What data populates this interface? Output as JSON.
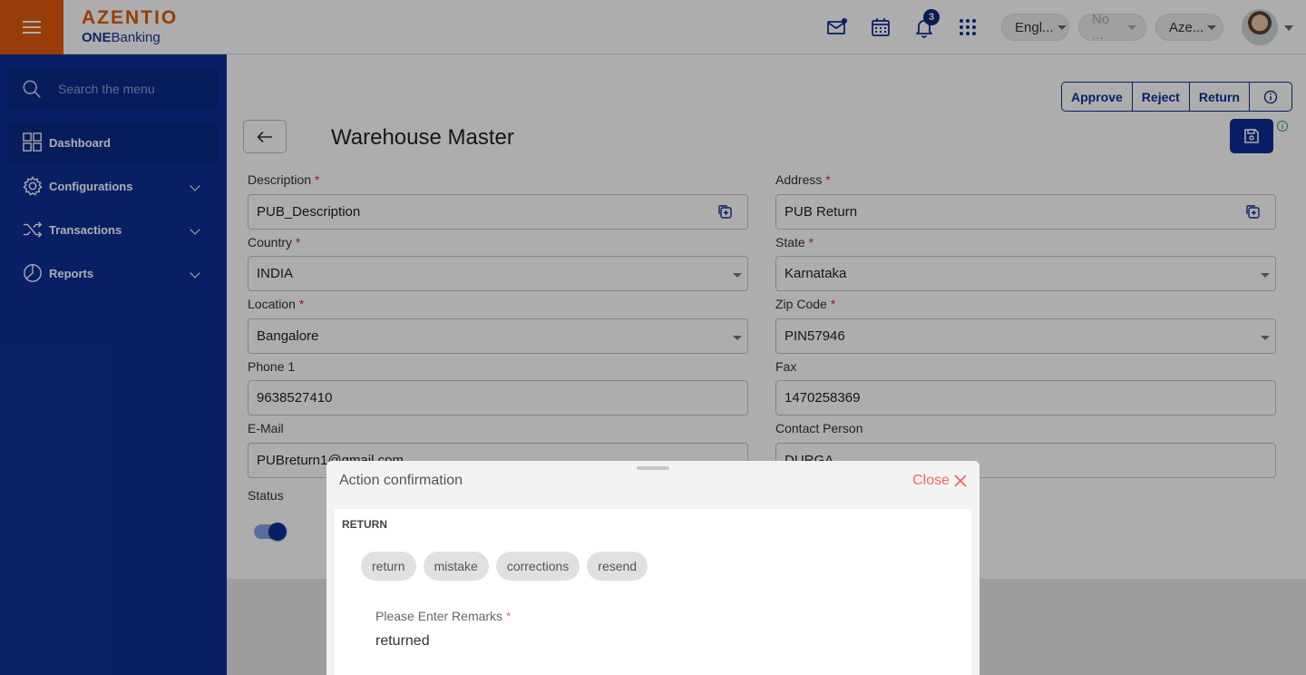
{
  "header": {
    "logo_main": "AZENTIO",
    "logo_sub_bold": "ONE",
    "logo_sub_rest": "Banking",
    "notification_count": "3",
    "language": "Engl...",
    "second_select": "No ...",
    "third_select": "Aze..."
  },
  "sidebar": {
    "search_placeholder": "Search the menu",
    "items": [
      {
        "label": "Dashboard",
        "icon": "dashboard-icon"
      },
      {
        "label": "Configurations",
        "icon": "gear-icon"
      },
      {
        "label": "Transactions",
        "icon": "shuffle-icon"
      },
      {
        "label": "Reports",
        "icon": "pie-chart-icon"
      }
    ]
  },
  "actions": {
    "approve": "Approve",
    "reject": "Reject",
    "return": "Return"
  },
  "page": {
    "title": "Warehouse Master"
  },
  "form": {
    "description": {
      "label": "Description",
      "value": "PUB_Description"
    },
    "address": {
      "label": "Address",
      "value": "PUB Return"
    },
    "country": {
      "label": "Country",
      "value": "INDIA"
    },
    "state": {
      "label": "State",
      "value": "Karnataka"
    },
    "location": {
      "label": "Location",
      "value": "Bangalore"
    },
    "zip": {
      "label": "Zip Code",
      "value": "PIN57946"
    },
    "phone1": {
      "label": "Phone 1",
      "value": "9638527410"
    },
    "fax": {
      "label": "Fax",
      "value": "1470258369"
    },
    "email": {
      "label": "E-Mail",
      "value": "PUBreturn1@gmail.com"
    },
    "contact": {
      "label": "Contact Person",
      "value": "DURGA"
    },
    "status": {
      "label": "Status",
      "on": true
    },
    "required_mark": "*"
  },
  "dialog": {
    "title": "Action confirmation",
    "close_label": "Close",
    "section": "RETURN",
    "chips": [
      "return",
      "mistake",
      "corrections",
      "resend"
    ],
    "remarks_label": "Please Enter Remarks",
    "remarks_value": "returned"
  },
  "colors": {
    "brand_orange": "#e05a10",
    "brand_navy": "#0e2f96",
    "required_red": "#d32f2f"
  }
}
